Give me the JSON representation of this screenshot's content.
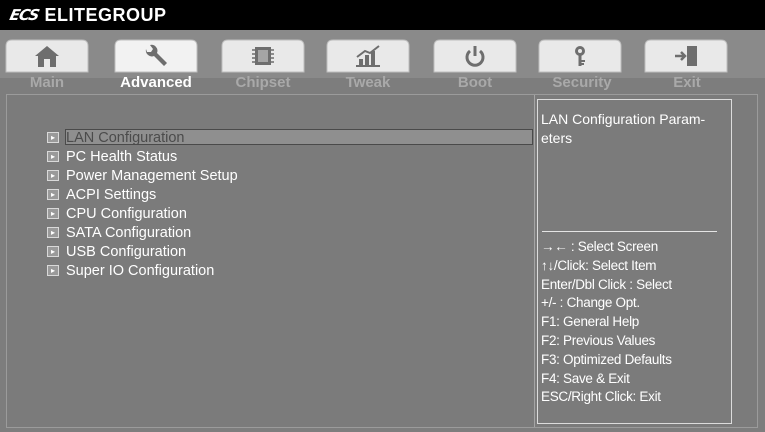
{
  "brand": {
    "mark": "ECS",
    "name": "ELITEGROUP"
  },
  "tabs": [
    {
      "label": "Main",
      "icon": "home-icon",
      "active": false
    },
    {
      "label": "Advanced",
      "icon": "wrench-icon",
      "active": true
    },
    {
      "label": "Chipset",
      "icon": "chip-icon",
      "active": false
    },
    {
      "label": "Tweak",
      "icon": "chart-icon",
      "active": false
    },
    {
      "label": "Boot",
      "icon": "power-icon",
      "active": false
    },
    {
      "label": "Security",
      "icon": "key-icon",
      "active": false
    },
    {
      "label": "Exit",
      "icon": "exit-door-icon",
      "active": false
    }
  ],
  "menu": {
    "items": [
      {
        "label": "LAN Configuration",
        "selected": true
      },
      {
        "label": "PC Health Status"
      },
      {
        "label": "Power Management Setup"
      },
      {
        "label": "ACPI Settings"
      },
      {
        "label": "CPU Configuration"
      },
      {
        "label": "SATA Configuration"
      },
      {
        "label": "USB Configuration"
      },
      {
        "label": "Super IO Configuration"
      }
    ]
  },
  "help": {
    "title": "LAN Configuration Param-eters",
    "keys": [
      "→← : Select Screen",
      "↑↓/Click: Select Item",
      "Enter/Dbl Click : Select",
      "+/- : Change Opt.",
      "F1: General Help",
      "F2: Previous Values",
      "F3: Optimized Defaults",
      "F4: Save & Exit",
      "ESC/Right Click: Exit"
    ]
  },
  "colors": {
    "background": "#7b7b7b",
    "header": "#000000",
    "tab_inactive_label": "#a9a9a9",
    "text": "#ffffff"
  }
}
